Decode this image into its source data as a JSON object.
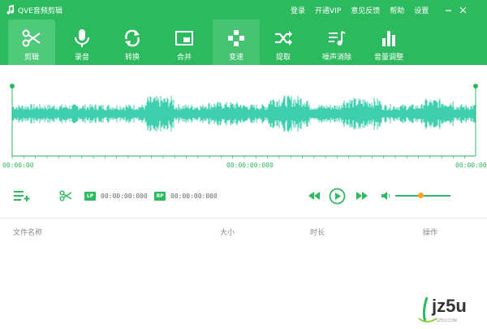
{
  "titlebar": {
    "app_title": "QVE音频剪辑",
    "menu": [
      "登录",
      "开通VIP",
      "意见反馈",
      "帮助",
      "设置"
    ]
  },
  "toolbar": {
    "tools": [
      {
        "label": "剪辑",
        "icon": "scissors-icon"
      },
      {
        "label": "录音",
        "icon": "microphone-icon"
      },
      {
        "label": "转换",
        "icon": "convert-icon"
      },
      {
        "label": "合并",
        "icon": "merge-icon"
      },
      {
        "label": "变速",
        "icon": "speed-icon"
      },
      {
        "label": "提取",
        "icon": "extract-icon"
      },
      {
        "label": "噪声消除",
        "icon": "denoise-icon"
      },
      {
        "label": "音量调整",
        "icon": "volume-adjust-icon"
      }
    ],
    "active_index": 0,
    "highlight_index": 4
  },
  "timeline": {
    "start_time": "00:00:00",
    "mid_time": "00:00:00:000",
    "end_time": "00:00:00"
  },
  "controls": {
    "lp_tag": "LP",
    "lp_time": "00:00:00:000",
    "rp_tag": "RP",
    "rp_time": "00:00:00:000",
    "volume_level": 0.47
  },
  "file_list": {
    "columns": [
      "文件名称",
      "大小",
      "时长",
      "操作"
    ]
  },
  "watermark": {
    "text": "jz5u",
    "sub_text": "JZ5U.COM"
  },
  "colors": {
    "brand": "#2dba5e",
    "wave": "#3fcfae",
    "slider_thumb": "#f5a623"
  }
}
